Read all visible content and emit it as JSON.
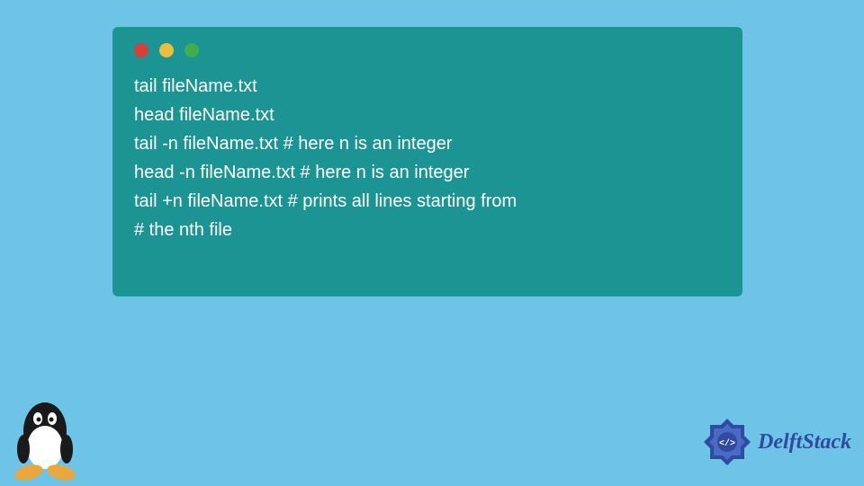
{
  "terminal": {
    "lines": [
      "tail fileName.txt",
      "head fileName.txt",
      "tail -n fileName.txt # here n is an integer",
      "head -n fileName.txt # here n is an integer",
      "tail +n fileName.txt # prints all lines starting from",
      "# the nth file"
    ]
  },
  "brand": {
    "name": "DelftStack"
  },
  "colors": {
    "background": "#6dc4e6",
    "terminal_bg": "#1c9494",
    "terminal_text": "#ffffff",
    "dot_red": "#d6403b",
    "dot_yellow": "#e9be3f",
    "dot_green": "#3fae4c",
    "brand_text": "#2f4aa0"
  }
}
